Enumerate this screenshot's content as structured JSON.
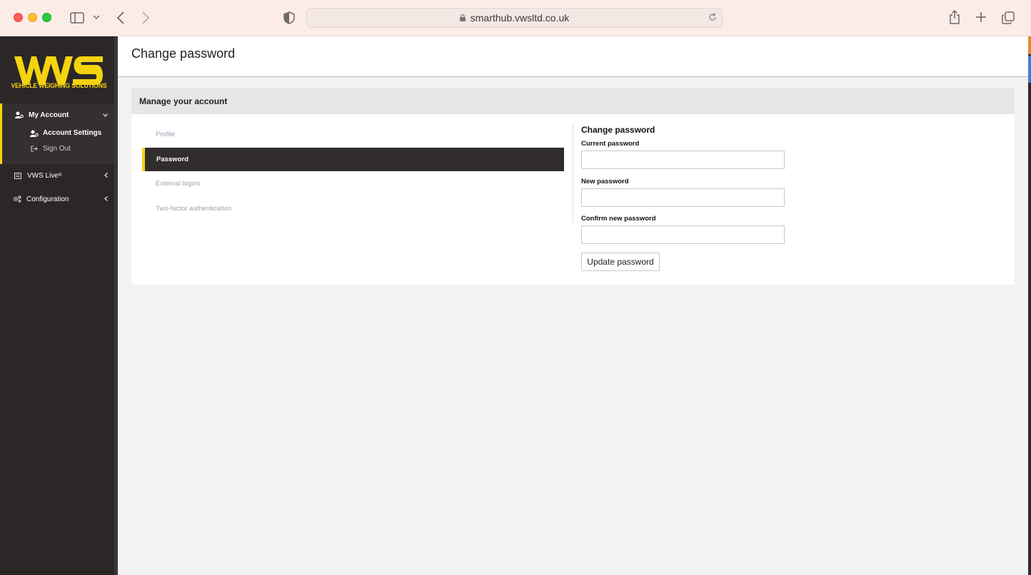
{
  "browser": {
    "url": "smarthub.vwsltd.co.uk"
  },
  "sidebar": {
    "logo_text": "VWS",
    "logo_subtitle": "VEHICLE WEIGHING SOLUTIONS",
    "brand_color": "#f5d30f",
    "items": [
      {
        "label": "My Account",
        "icon": "user-gear-icon",
        "expanded": true,
        "children": [
          {
            "label": "Account Settings",
            "icon": "user-gear-icon",
            "active": true
          },
          {
            "label": "Sign Out",
            "icon": "sign-out-icon"
          }
        ]
      },
      {
        "label": "VWS Live",
        "superscript": "®",
        "icon": "list-icon",
        "expanded": false
      },
      {
        "label": "Configuration",
        "icon": "cogs-icon",
        "expanded": false
      }
    ]
  },
  "header": {
    "title": "Change password"
  },
  "card": {
    "title": "Manage your account",
    "tabs": [
      {
        "label": "Profile",
        "active": false
      },
      {
        "label": "Password",
        "active": true
      },
      {
        "label": "External logins",
        "active": false
      },
      {
        "label": "Two-factor authentication",
        "active": false
      }
    ]
  },
  "form": {
    "title": "Change password",
    "current_label": "Current password",
    "current_value": "",
    "new_label": "New password",
    "new_value": "",
    "confirm_label": "Confirm new password",
    "confirm_value": "",
    "submit_label": "Update password"
  }
}
